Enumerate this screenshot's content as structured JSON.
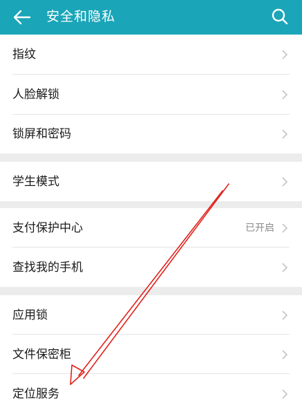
{
  "header": {
    "title": "安全和隐私",
    "back_icon": "arrow-left-icon",
    "search_icon": "search-icon",
    "color": "#1aa5b8"
  },
  "groups": [
    {
      "items": [
        {
          "label": "指纹"
        },
        {
          "label": "人脸解锁"
        },
        {
          "label": "锁屏和密码"
        }
      ]
    },
    {
      "items": [
        {
          "label": "学生模式"
        }
      ]
    },
    {
      "items": [
        {
          "label": "支付保护中心",
          "status": "已开启"
        },
        {
          "label": "查找我的手机"
        }
      ]
    },
    {
      "items": [
        {
          "label": "应用锁"
        },
        {
          "label": "文件保密柜"
        },
        {
          "label": "定位服务"
        }
      ]
    }
  ],
  "annotation": {
    "arrow_color": "#e0201a"
  }
}
